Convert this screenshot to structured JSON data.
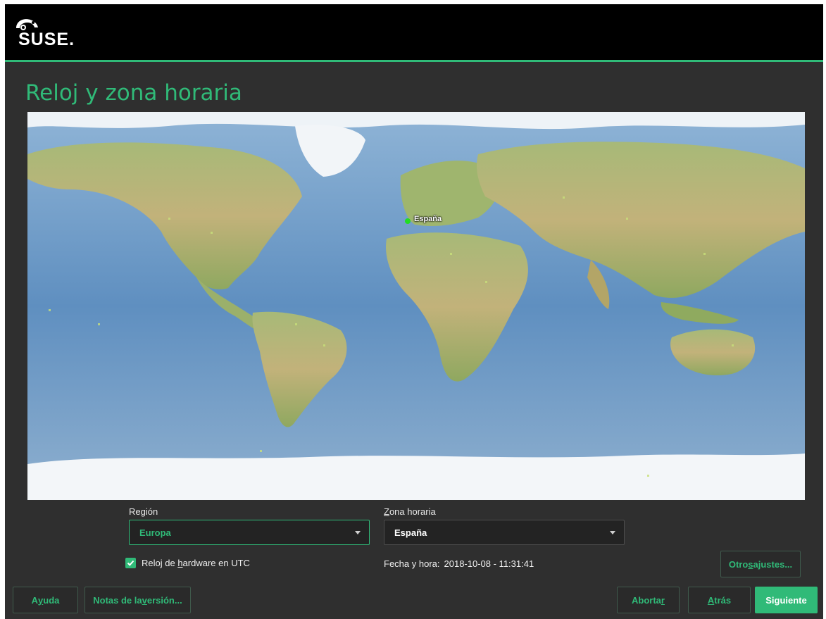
{
  "header": {
    "logo_text": "SUSE.",
    "accent_color": "#30ba78"
  },
  "page": {
    "title": "Reloj y zona horaria"
  },
  "map": {
    "selected_marker_label": "España",
    "marker_color": "#22dd22"
  },
  "region": {
    "label": "Región",
    "value": "Europa"
  },
  "timezone": {
    "label_first": "Z",
    "label_rest": "ona horaria",
    "value": "España"
  },
  "utc_clock": {
    "checked": true,
    "label_before": "Reloj de ",
    "label_mnemonic": "h",
    "label_after": "ardware en UTC"
  },
  "datetime": {
    "label": "Fecha y hora:",
    "value": "2018-10-08 - 11:31:41"
  },
  "buttons": {
    "other_settings_before": "Otro",
    "other_settings_mnemonic": "s",
    "other_settings_after": " ajustes...",
    "help_before": "A",
    "help_mnemonic": "y",
    "help_after": "uda",
    "release_notes_before": "Notas de la ",
    "release_notes_mnemonic": "v",
    "release_notes_after": "ersión...",
    "abort_before": "Aborta",
    "abort_mnemonic": "r",
    "abort_after": "",
    "back_before": "",
    "back_mnemonic": "A",
    "back_after": "trás",
    "next": "Siguiente"
  }
}
